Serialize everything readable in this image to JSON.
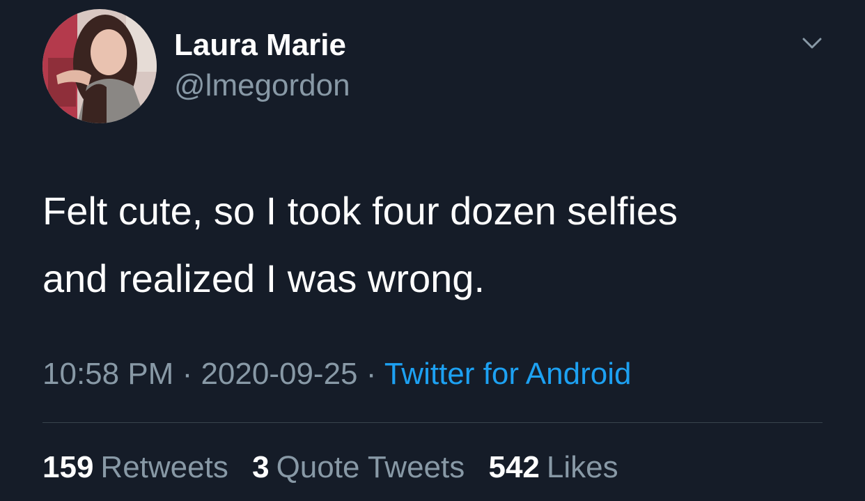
{
  "user": {
    "display_name": "Laura Marie",
    "handle": "@lmegordon",
    "avatar_icon": "profile-photo"
  },
  "menu": {
    "icon": "chevron-down-icon"
  },
  "tweet": {
    "lines": [
      "Felt cute, so I took four dozen selfies",
      "and realized I was wrong."
    ]
  },
  "meta": {
    "time": "10:58 PM",
    "separator": " · ",
    "date": "2020-09-25",
    "source": "Twitter for Android"
  },
  "stats": {
    "retweets_count": "159",
    "retweets_label": "Retweets",
    "quotes_count": "3",
    "quotes_label": "Quote Tweets",
    "likes_count": "542",
    "likes_label": "Likes"
  },
  "colors": {
    "background": "#151c28",
    "secondary_text": "#8899a6",
    "link": "#1da1f2",
    "divider": "#38444d"
  }
}
